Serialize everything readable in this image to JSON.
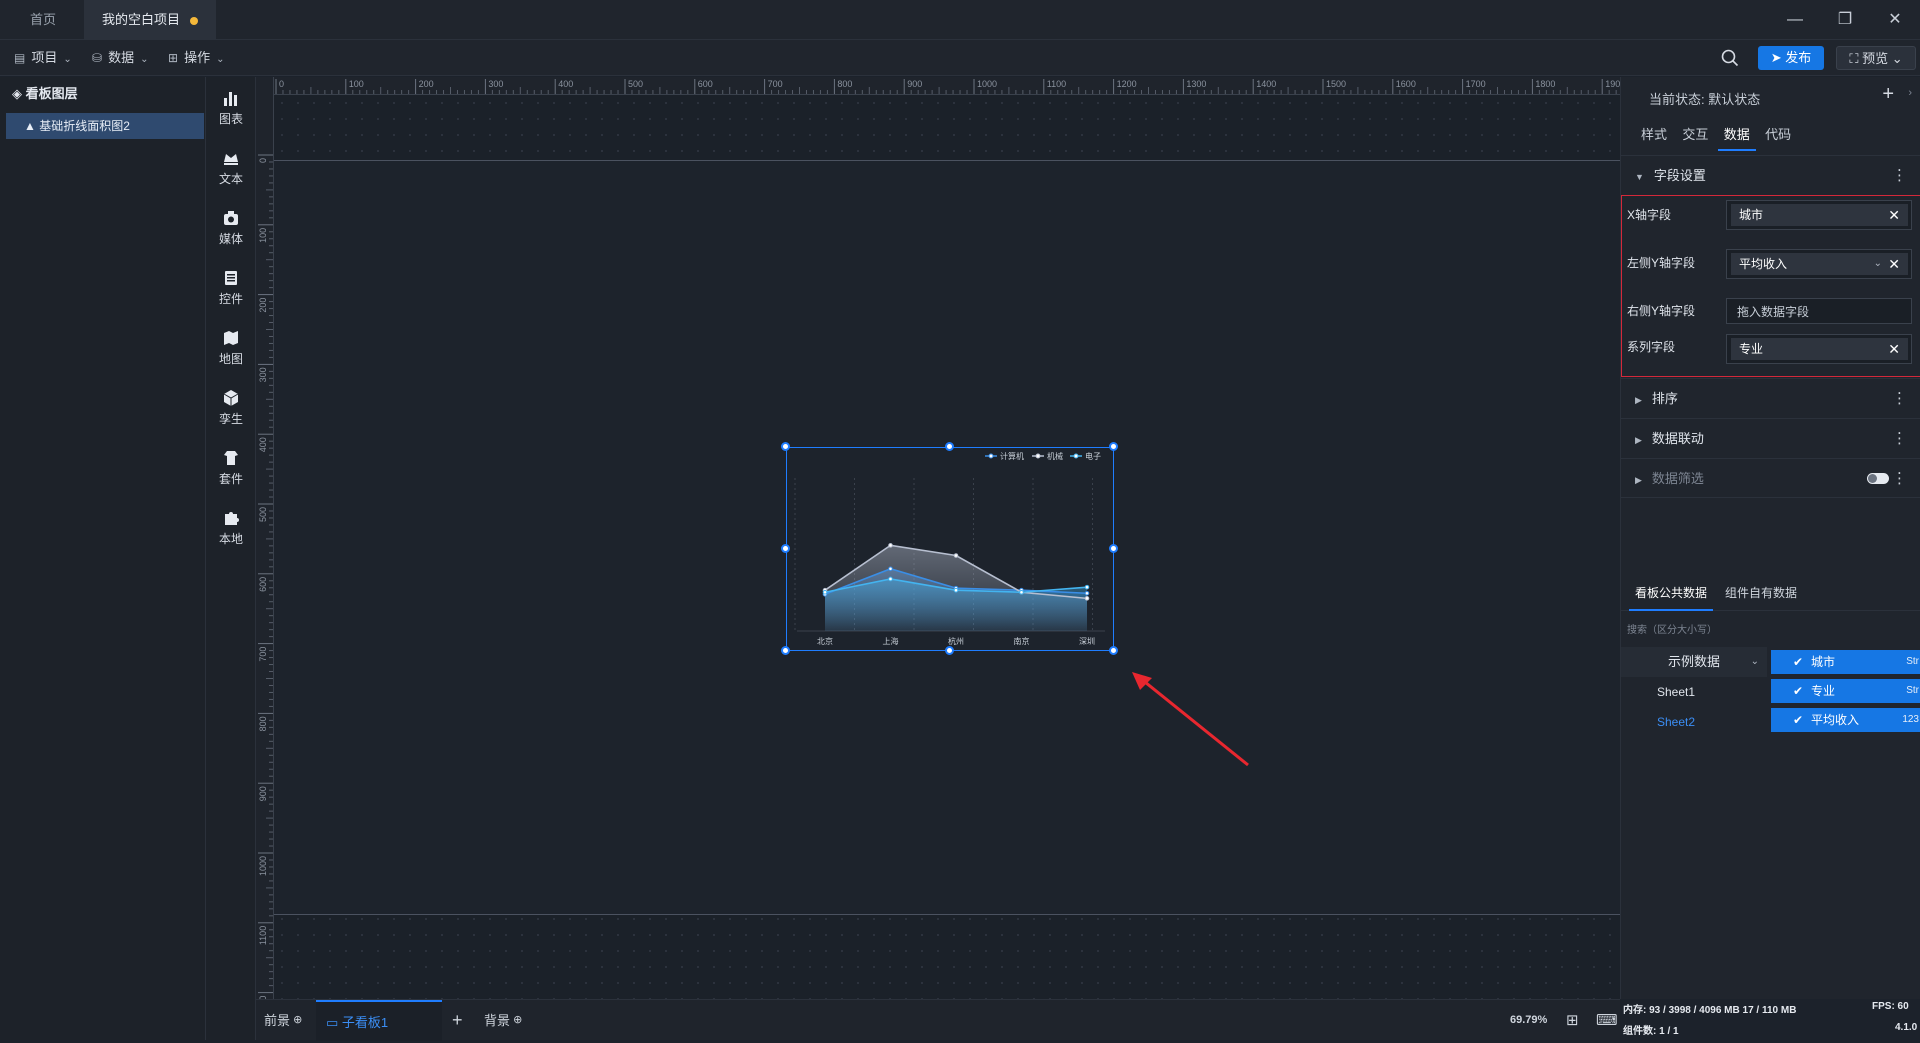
{
  "titlebar": {
    "tabs": [
      "首页",
      "我的空白项目"
    ],
    "window_controls": [
      "—",
      "❐",
      "✕"
    ]
  },
  "menubar": {
    "items": [
      {
        "icon": "file-icon",
        "label": "项目"
      },
      {
        "icon": "database-icon",
        "label": "数据"
      },
      {
        "icon": "grid-icon",
        "label": "操作"
      }
    ],
    "publish_label": "发布",
    "preview_label": "预览"
  },
  "layers": {
    "title": "看板图层",
    "items": [
      "基础折线面积图2"
    ]
  },
  "components": [
    {
      "icon": "chart-icon",
      "label": "图表"
    },
    {
      "icon": "text-icon",
      "label": "文本"
    },
    {
      "icon": "media-icon",
      "label": "媒体"
    },
    {
      "icon": "control-icon",
      "label": "控件"
    },
    {
      "icon": "map-icon",
      "label": "地图"
    },
    {
      "icon": "cube-icon",
      "label": "孪生"
    },
    {
      "icon": "kit-icon",
      "label": "套件"
    },
    {
      "icon": "puzzle-icon",
      "label": "本地"
    }
  ],
  "rulers": {
    "h_labels": [
      "0",
      "100",
      "200",
      "300",
      "400",
      "500",
      "600",
      "700",
      "800",
      "900",
      "1000",
      "1100",
      "1200",
      "1300",
      "1400",
      "1500",
      "1600",
      "1700",
      "1800",
      "1900"
    ],
    "v_labels": [
      "0",
      "100",
      "200",
      "300",
      "400",
      "500",
      "600",
      "700",
      "800",
      "900",
      "1000",
      "1100",
      "1200"
    ]
  },
  "chart_data": {
    "type": "area",
    "categories": [
      "北京",
      "上海",
      "杭州",
      "南京",
      "深圳"
    ],
    "series": [
      {
        "name": "计算机",
        "values": [
          36,
          61,
          42,
          40,
          37
        ],
        "color": "#3a8ee6"
      },
      {
        "name": "机械",
        "values": [
          40,
          84,
          74,
          38,
          32
        ],
        "color": "#b7bfd0"
      },
      {
        "name": "电子",
        "values": [
          38,
          51,
          40,
          38,
          43
        ],
        "color": "#43b4f0"
      }
    ],
    "ylim": [
      0,
      150
    ],
    "legend_position": "top-right",
    "grid": "vertical-dashed"
  },
  "bottombar": {
    "tabs": [
      "前景",
      "子看板1",
      "背景"
    ],
    "zoom": "69.79%"
  },
  "rpanel": {
    "status_label": "当前状态:",
    "status_value": "默认状态",
    "tabs": [
      "样式",
      "交互",
      "数据",
      "代码"
    ],
    "active_tab": "数据",
    "sections": {
      "field_settings": "字段设置",
      "sort": "排序",
      "linkage": "数据联动",
      "filter": "数据筛选"
    },
    "fields": [
      {
        "label": "X轴字段",
        "value": "城市"
      },
      {
        "label": "左侧Y轴字段",
        "value": "平均收入"
      },
      {
        "label": "右侧Y轴字段",
        "placeholder": "拖入数据字段"
      },
      {
        "label": "系列字段",
        "value": "专业"
      }
    ],
    "data_tabs": [
      "看板公共数据",
      "组件自有数据"
    ],
    "search_hint": "搜索（区分大小写）",
    "source": "示例数据",
    "sheets": [
      "Sheet1",
      "Sheet2"
    ],
    "columns": [
      {
        "name": "城市",
        "type": "Str"
      },
      {
        "name": "专业",
        "type": "Str"
      },
      {
        "name": "平均收入",
        "type": "123"
      }
    ]
  },
  "sysinfo": {
    "memory": "内存: 93 / 3998 / 4096 MB  17 / 110 MB",
    "fps": "FPS: 60",
    "count": "组件数: 1 / 1",
    "version": "4.1.0"
  },
  "colors": {
    "accent": "#1f7dff",
    "highlight_border": "#d4283a"
  }
}
